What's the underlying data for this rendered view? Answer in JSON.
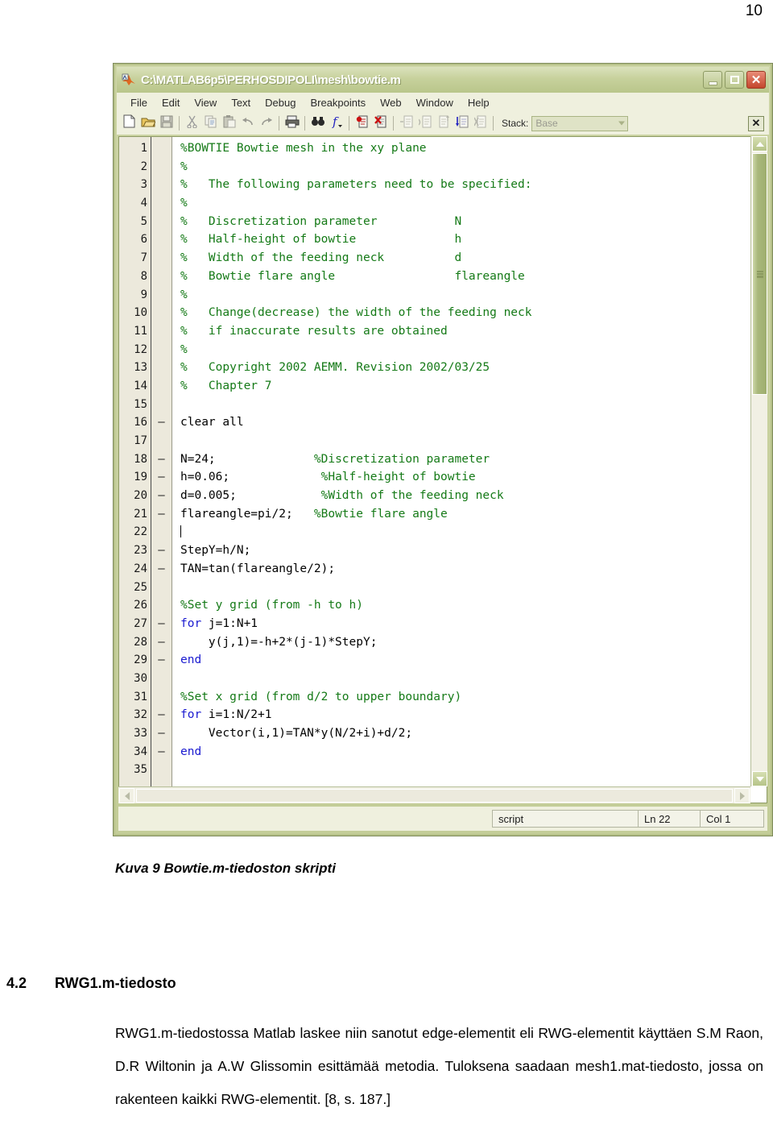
{
  "page": {
    "number": "10"
  },
  "window": {
    "title": "C:\\MATLAB6p5\\PERHOSDIPOLI\\mesh\\bowtie.m",
    "icon": "matlab-logo-icon",
    "buttons": {
      "minimize": "_",
      "maximize": "☐",
      "close": "✕"
    }
  },
  "menubar": {
    "items": [
      {
        "label": "File"
      },
      {
        "label": "Edit"
      },
      {
        "label": "View"
      },
      {
        "label": "Text"
      },
      {
        "label": "Debug"
      },
      {
        "label": "Breakpoints"
      },
      {
        "label": "Web"
      },
      {
        "label": "Window"
      },
      {
        "label": "Help"
      }
    ]
  },
  "toolbar": {
    "buttons": [
      {
        "name": "new-file-icon",
        "tip": "New"
      },
      {
        "name": "open-file-icon",
        "tip": "Open"
      },
      {
        "name": "save-file-icon",
        "tip": "Save"
      },
      {
        "name": "cut-icon",
        "tip": "Cut"
      },
      {
        "name": "copy-icon",
        "tip": "Copy"
      },
      {
        "name": "paste-icon",
        "tip": "Paste"
      },
      {
        "name": "undo-icon",
        "tip": "Undo"
      },
      {
        "name": "redo-icon",
        "tip": "Redo"
      },
      {
        "name": "print-icon",
        "tip": "Print"
      },
      {
        "name": "find-icon",
        "tip": "Find"
      },
      {
        "name": "function-icon",
        "tip": "Function"
      },
      {
        "name": "set-breakpoint-icon",
        "tip": "Set/Clear Breakpoint"
      },
      {
        "name": "clear-breakpoints-icon",
        "tip": "Clear All Breakpoints"
      },
      {
        "name": "step-icon",
        "tip": "Step"
      },
      {
        "name": "step-in-icon",
        "tip": "Step In"
      },
      {
        "name": "step-out-icon",
        "tip": "Step Out"
      },
      {
        "name": "continue-icon",
        "tip": "Continue"
      },
      {
        "name": "exit-debug-icon",
        "tip": "Exit Debug Mode"
      }
    ],
    "stack_label": "Stack:",
    "stack_value": "Base",
    "close_label": "✕"
  },
  "editor": {
    "lines": [
      {
        "n": "1",
        "exec": false,
        "segments": [
          {
            "t": "%BOWTIE Bowtie mesh in the xy plane",
            "c": "cmt"
          }
        ]
      },
      {
        "n": "2",
        "exec": false,
        "segments": [
          {
            "t": "%",
            "c": "cmt"
          }
        ]
      },
      {
        "n": "3",
        "exec": false,
        "segments": [
          {
            "t": "%   The following parameters need to be specified:",
            "c": "cmt"
          }
        ]
      },
      {
        "n": "4",
        "exec": false,
        "segments": [
          {
            "t": "%",
            "c": "cmt"
          }
        ]
      },
      {
        "n": "5",
        "exec": false,
        "segments": [
          {
            "t": "%   Discretization parameter           N",
            "c": "cmt"
          }
        ]
      },
      {
        "n": "6",
        "exec": false,
        "segments": [
          {
            "t": "%   Half-height of bowtie              h",
            "c": "cmt"
          }
        ]
      },
      {
        "n": "7",
        "exec": false,
        "segments": [
          {
            "t": "%   Width of the feeding neck          d",
            "c": "cmt"
          }
        ]
      },
      {
        "n": "8",
        "exec": false,
        "segments": [
          {
            "t": "%   Bowtie flare angle                 flareangle",
            "c": "cmt"
          }
        ]
      },
      {
        "n": "9",
        "exec": false,
        "segments": [
          {
            "t": "%",
            "c": "cmt"
          }
        ]
      },
      {
        "n": "10",
        "exec": false,
        "segments": [
          {
            "t": "%   Change(decrease) the width of the feeding neck",
            "c": "cmt"
          }
        ]
      },
      {
        "n": "11",
        "exec": false,
        "segments": [
          {
            "t": "%   if inaccurate results are obtained",
            "c": "cmt"
          }
        ]
      },
      {
        "n": "12",
        "exec": false,
        "segments": [
          {
            "t": "%",
            "c": "cmt"
          }
        ]
      },
      {
        "n": "13",
        "exec": false,
        "segments": [
          {
            "t": "%   Copyright 2002 AEMM. Revision 2002/03/25",
            "c": "cmt"
          }
        ]
      },
      {
        "n": "14",
        "exec": false,
        "segments": [
          {
            "t": "%   Chapter 7",
            "c": "cmt"
          }
        ]
      },
      {
        "n": "15",
        "exec": false,
        "segments": []
      },
      {
        "n": "16",
        "exec": true,
        "segments": [
          {
            "t": "clear all",
            "c": ""
          }
        ]
      },
      {
        "n": "17",
        "exec": false,
        "segments": []
      },
      {
        "n": "18",
        "exec": true,
        "segments": [
          {
            "t": "N=24;              ",
            "c": ""
          },
          {
            "t": "%Discretization parameter",
            "c": "cmt"
          }
        ]
      },
      {
        "n": "19",
        "exec": true,
        "segments": [
          {
            "t": "h=0.06;             ",
            "c": ""
          },
          {
            "t": "%Half-height of bowtie",
            "c": "cmt"
          }
        ]
      },
      {
        "n": "20",
        "exec": true,
        "segments": [
          {
            "t": "d=0.005;            ",
            "c": ""
          },
          {
            "t": "%Width of the feeding neck",
            "c": "cmt"
          }
        ]
      },
      {
        "n": "21",
        "exec": true,
        "segments": [
          {
            "t": "flareangle=pi/2;   ",
            "c": ""
          },
          {
            "t": "%Bowtie flare angle",
            "c": "cmt"
          }
        ]
      },
      {
        "n": "22",
        "exec": false,
        "segments": [],
        "caret": true
      },
      {
        "n": "23",
        "exec": true,
        "segments": [
          {
            "t": "StepY=h/N;",
            "c": ""
          }
        ]
      },
      {
        "n": "24",
        "exec": true,
        "segments": [
          {
            "t": "TAN=tan(flareangle/2);",
            "c": ""
          }
        ]
      },
      {
        "n": "25",
        "exec": false,
        "segments": []
      },
      {
        "n": "26",
        "exec": false,
        "segments": [
          {
            "t": "%Set y grid (from -h to h)",
            "c": "cmt"
          }
        ]
      },
      {
        "n": "27",
        "exec": true,
        "segments": [
          {
            "t": "for",
            "c": "kw"
          },
          {
            "t": " j=1:N+1",
            "c": ""
          }
        ]
      },
      {
        "n": "28",
        "exec": true,
        "segments": [
          {
            "t": "    y(j,1)=-h+2*(j-1)*StepY;",
            "c": ""
          }
        ]
      },
      {
        "n": "29",
        "exec": true,
        "segments": [
          {
            "t": "end",
            "c": "kw"
          }
        ]
      },
      {
        "n": "30",
        "exec": false,
        "segments": []
      },
      {
        "n": "31",
        "exec": false,
        "segments": [
          {
            "t": "%Set x grid (from d/2 to upper boundary)",
            "c": "cmt"
          }
        ]
      },
      {
        "n": "32",
        "exec": true,
        "segments": [
          {
            "t": "for",
            "c": "kw"
          },
          {
            "t": " i=1:N/2+1",
            "c": ""
          }
        ]
      },
      {
        "n": "33",
        "exec": true,
        "segments": [
          {
            "t": "    Vector(i,1)=TAN*y(N/2+i)+d/2;",
            "c": ""
          }
        ]
      },
      {
        "n": "34",
        "exec": true,
        "segments": [
          {
            "t": "end",
            "c": "kw"
          }
        ]
      },
      {
        "n": "35",
        "exec": false,
        "segments": []
      }
    ],
    "exec_mark": "–"
  },
  "statusbar": {
    "file_type": "script",
    "line": "Ln 22",
    "column": "Col 1"
  },
  "document": {
    "caption": "Kuva 9 Bowtie.m-tiedoston skripti",
    "heading_number": "4.2",
    "heading_title": "RWG1.m-tiedosto",
    "paragraph": "RWG1.m-tiedostossa Matlab laskee niin sanotut edge-elementit eli RWG-elementit käyttäen S.M Raon, D.R Wiltonin ja A.W Glissomin esittämää metodia. Tuloksena saadaan mesh1.mat-tiedosto, jossa on rakenteen kaikki RWG-elementit. [8, s. 187.]"
  },
  "colors": {
    "comment": "#157a17",
    "keyword": "#1a1ad0",
    "code": "#000000",
    "window_chrome": "#c3cd98",
    "toolbar_bg": "#eff0de",
    "scrollbar_thumb": "#a9b87c"
  }
}
